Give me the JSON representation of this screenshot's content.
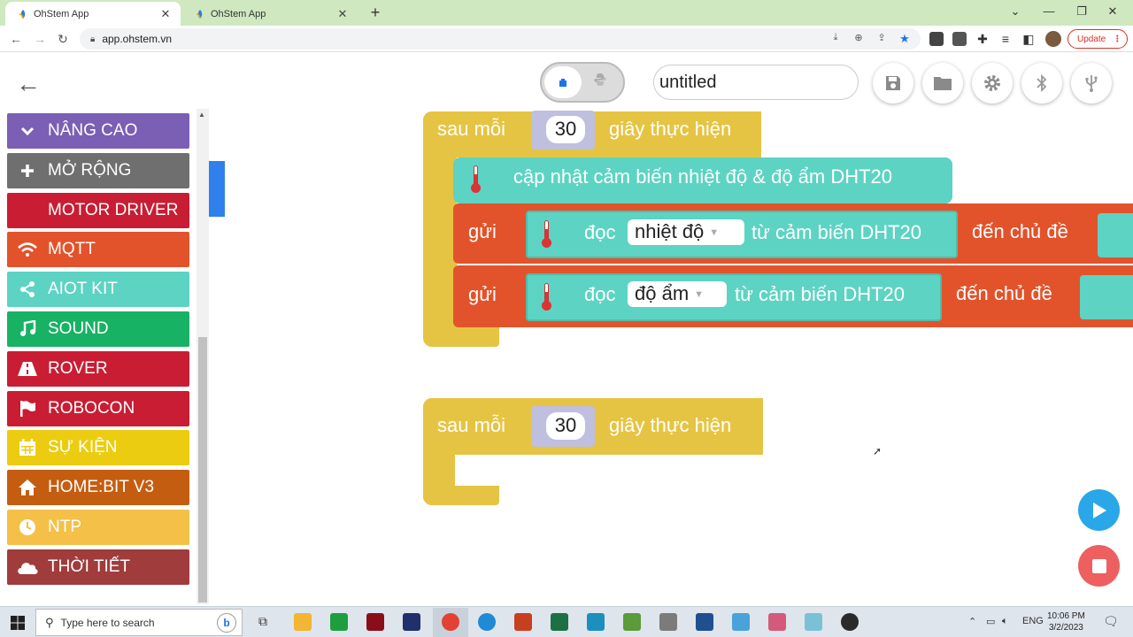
{
  "browser": {
    "tabs": [
      {
        "title": "OhStem App",
        "active": true
      },
      {
        "title": "OhStem App",
        "active": false
      }
    ],
    "url": "app.ohstem.vn",
    "update_label": "Update"
  },
  "app": {
    "project_title": "untitled",
    "categories": [
      {
        "label": "NÂNG CAO",
        "color": "#7b5fb4",
        "icon": "chevron-down-icon"
      },
      {
        "label": "MỞ RỘNG",
        "color": "#6f6f6f",
        "icon": "plus-icon"
      },
      {
        "label": "MOTOR DRIVER",
        "color": "#c91d33",
        "icon": ""
      },
      {
        "label": "MQTT",
        "color": "#e2532b",
        "icon": "wifi-icon"
      },
      {
        "label": "AIOT KIT",
        "color": "#5dd3c3",
        "icon": "share-icon"
      },
      {
        "label": "SOUND",
        "color": "#18b264",
        "icon": "music-note-icon"
      },
      {
        "label": "ROVER",
        "color": "#c91d33",
        "icon": "road-icon"
      },
      {
        "label": "ROBOCON",
        "color": "#c91d33",
        "icon": "flag-icon"
      },
      {
        "label": "SỰ KIỆN",
        "color": "#eccc10",
        "icon": "calendar-icon"
      },
      {
        "label": "HOME:BIT V3",
        "color": "#c55d10",
        "icon": "home-icon"
      },
      {
        "label": "NTP",
        "color": "#f4c048",
        "icon": "clock-icon"
      },
      {
        "label": "THỜI TIẾT",
        "color": "#a03c3c",
        "icon": "cloud-icon"
      }
    ]
  },
  "blocks": {
    "loop1": {
      "prefix": "sau mỗi",
      "seconds": "30",
      "suffix": "giây thực hiện"
    },
    "update_sensor": "cập nhật cảm biến nhiệt độ & độ ẩm DHT20",
    "send1": {
      "send": "gửi",
      "read": "đọc",
      "option": "nhiệt độ",
      "from": "từ cảm biến DHT20",
      "topic": "đến chủ đề"
    },
    "send2": {
      "send": "gửi",
      "read": "đọc",
      "option": "độ ẩm",
      "from": "từ cảm biến DHT20",
      "topic": "đến chủ đề"
    },
    "loop2": {
      "prefix": "sau mỗi",
      "seconds": "30",
      "suffix": "giây thực hiện"
    }
  },
  "taskbar": {
    "search_placeholder": "Type here to search",
    "language": "ENG",
    "time": "10:06 PM",
    "date": "3/2/2023"
  }
}
